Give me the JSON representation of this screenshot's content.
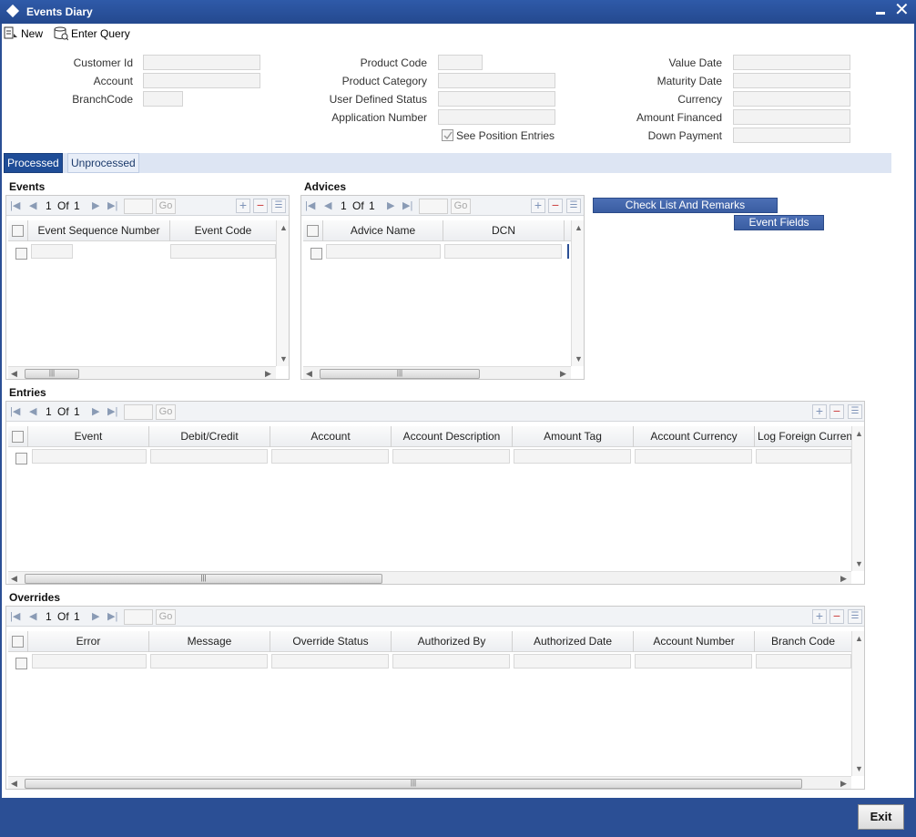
{
  "window": {
    "title": "Events Diary"
  },
  "toolbar": {
    "new_label": "New",
    "enter_query_label": "Enter Query"
  },
  "header_fields": {
    "customer_id": "Customer Id",
    "account": "Account",
    "branch_code": "BranchCode",
    "product_code": "Product Code",
    "product_category": "Product Category",
    "user_defined_status": "User Defined Status",
    "application_number": "Application Number",
    "see_position_entries": "See Position Entries",
    "value_date": "Value Date",
    "maturity_date": "Maturity Date",
    "currency": "Currency",
    "amount_financed": "Amount Financed",
    "down_payment": "Down Payment"
  },
  "tabs": [
    {
      "label": "Processed"
    },
    {
      "label": "Unprocessed"
    }
  ],
  "events": {
    "title": "Events",
    "page": "1",
    "of": "Of",
    "total": "1",
    "go": "Go",
    "columns": [
      "Event Sequence Number",
      "Event Code"
    ]
  },
  "advices": {
    "title": "Advices",
    "page": "1",
    "of": "Of",
    "total": "1",
    "go": "Go",
    "columns": [
      "Advice Name",
      "DCN"
    ]
  },
  "buttons": {
    "check_list": "Check List And Remarks",
    "event_fields": "Event Fields",
    "exit": "Exit"
  },
  "entries": {
    "title": "Entries",
    "page": "1",
    "of": "Of",
    "total": "1",
    "go": "Go",
    "columns": [
      "Event",
      "Debit/Credit",
      "Account",
      "Account Description",
      "Amount Tag",
      "Account Currency",
      "Log Foreign Curren"
    ]
  },
  "overrides": {
    "title": "Overrides",
    "page": "1",
    "of": "Of",
    "total": "1",
    "go": "Go",
    "columns": [
      "Error",
      "Message",
      "Override Status",
      "Authorized By",
      "Authorized Date",
      "Account Number",
      "Branch Code"
    ]
  },
  "icons": {
    "first": "first-page-icon",
    "prev": "previous-page-icon",
    "next": "next-page-icon",
    "last": "last-page-icon",
    "add": "add-row-icon",
    "delete": "delete-row-icon",
    "view": "single-view-icon"
  }
}
